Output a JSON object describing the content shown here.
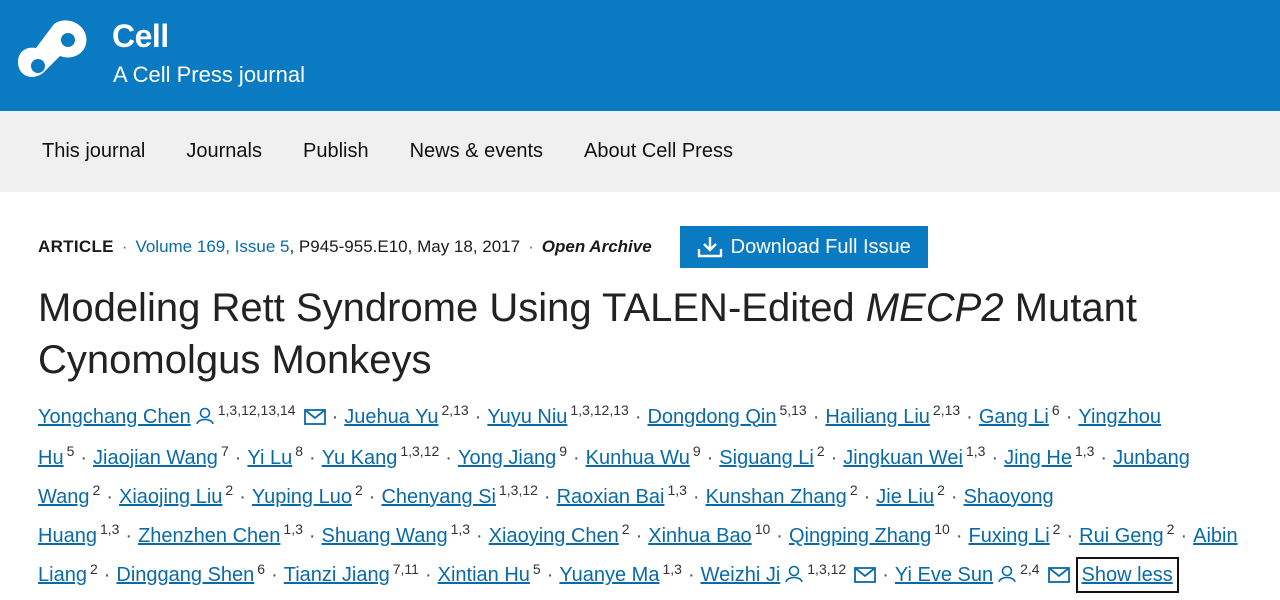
{
  "header": {
    "brand": "Cell",
    "tagline": "A Cell Press journal"
  },
  "nav": [
    {
      "label": "This journal"
    },
    {
      "label": "Journals"
    },
    {
      "label": "Publish"
    },
    {
      "label": "News & events"
    },
    {
      "label": "About Cell Press"
    }
  ],
  "article": {
    "type": "ARTICLE",
    "volume": "Volume 169, Issue 5",
    "pages": ", P945-955.E10, May 18, 2017",
    "access": "Open Archive",
    "download_label": "Download Full Issue",
    "title_part1": "Modeling Rett Syndrome Using TALEN-Edited ",
    "title_italic": "MECP2",
    "title_part2": " Mutant Cynomolgus Monkeys"
  },
  "authors": [
    {
      "name": "Yongchang Chen",
      "aff": "1,3,12,13,14",
      "person": true,
      "mail": true
    },
    {
      "name": "Juehua Yu",
      "aff": "2,13"
    },
    {
      "name": "Yuyu Niu",
      "aff": "1,3,12,13"
    },
    {
      "name": "Dongdong Qin",
      "aff": "5,13"
    },
    {
      "name": "Hailiang Liu",
      "aff": "2,13"
    },
    {
      "name": "Gang Li",
      "aff": "6"
    },
    {
      "name": "Yingzhou Hu",
      "aff": "5"
    },
    {
      "name": "Jiaojian Wang",
      "aff": "7"
    },
    {
      "name": "Yi Lu",
      "aff": "8"
    },
    {
      "name": "Yu Kang",
      "aff": "1,3,12"
    },
    {
      "name": "Yong Jiang",
      "aff": "9"
    },
    {
      "name": "Kunhua Wu",
      "aff": "9"
    },
    {
      "name": "Siguang Li",
      "aff": "2"
    },
    {
      "name": "Jingkuan Wei",
      "aff": "1,3"
    },
    {
      "name": "Jing He",
      "aff": "1,3"
    },
    {
      "name": "Junbang Wang",
      "aff": "2"
    },
    {
      "name": "Xiaojing Liu",
      "aff": "2"
    },
    {
      "name": "Yuping Luo",
      "aff": "2"
    },
    {
      "name": "Chenyang Si",
      "aff": "1,3,12"
    },
    {
      "name": "Raoxian Bai",
      "aff": "1,3"
    },
    {
      "name": "Kunshan Zhang",
      "aff": "2"
    },
    {
      "name": "Jie Liu",
      "aff": "2"
    },
    {
      "name": "Shaoyong Huang",
      "aff": "1,3"
    },
    {
      "name": "Zhenzhen Chen",
      "aff": "1,3"
    },
    {
      "name": "Shuang Wang",
      "aff": "1,3"
    },
    {
      "name": "Xiaoying Chen",
      "aff": "2"
    },
    {
      "name": "Xinhua Bao",
      "aff": "10"
    },
    {
      "name": "Qingping Zhang",
      "aff": "10"
    },
    {
      "name": "Fuxing Li",
      "aff": "2"
    },
    {
      "name": "Rui Geng",
      "aff": "2"
    },
    {
      "name": "Aibin Liang",
      "aff": "2"
    },
    {
      "name": "Dinggang Shen",
      "aff": "6"
    },
    {
      "name": "Tianzi Jiang",
      "aff": "7,11"
    },
    {
      "name": "Xintian Hu",
      "aff": "5"
    },
    {
      "name": "Yuanye Ma",
      "aff": "1,3"
    },
    {
      "name": "Weizhi Ji",
      "aff": "1,3,12",
      "person": true,
      "mail": true
    },
    {
      "name": "Yi Eve Sun",
      "aff": "2,4",
      "person": true,
      "mail": true
    }
  ],
  "show_less_label": "Show less",
  "colors": {
    "brand_blue": "#0a7ac2",
    "link": "#0a6aa8",
    "nav_bg": "#f0f0f0"
  }
}
